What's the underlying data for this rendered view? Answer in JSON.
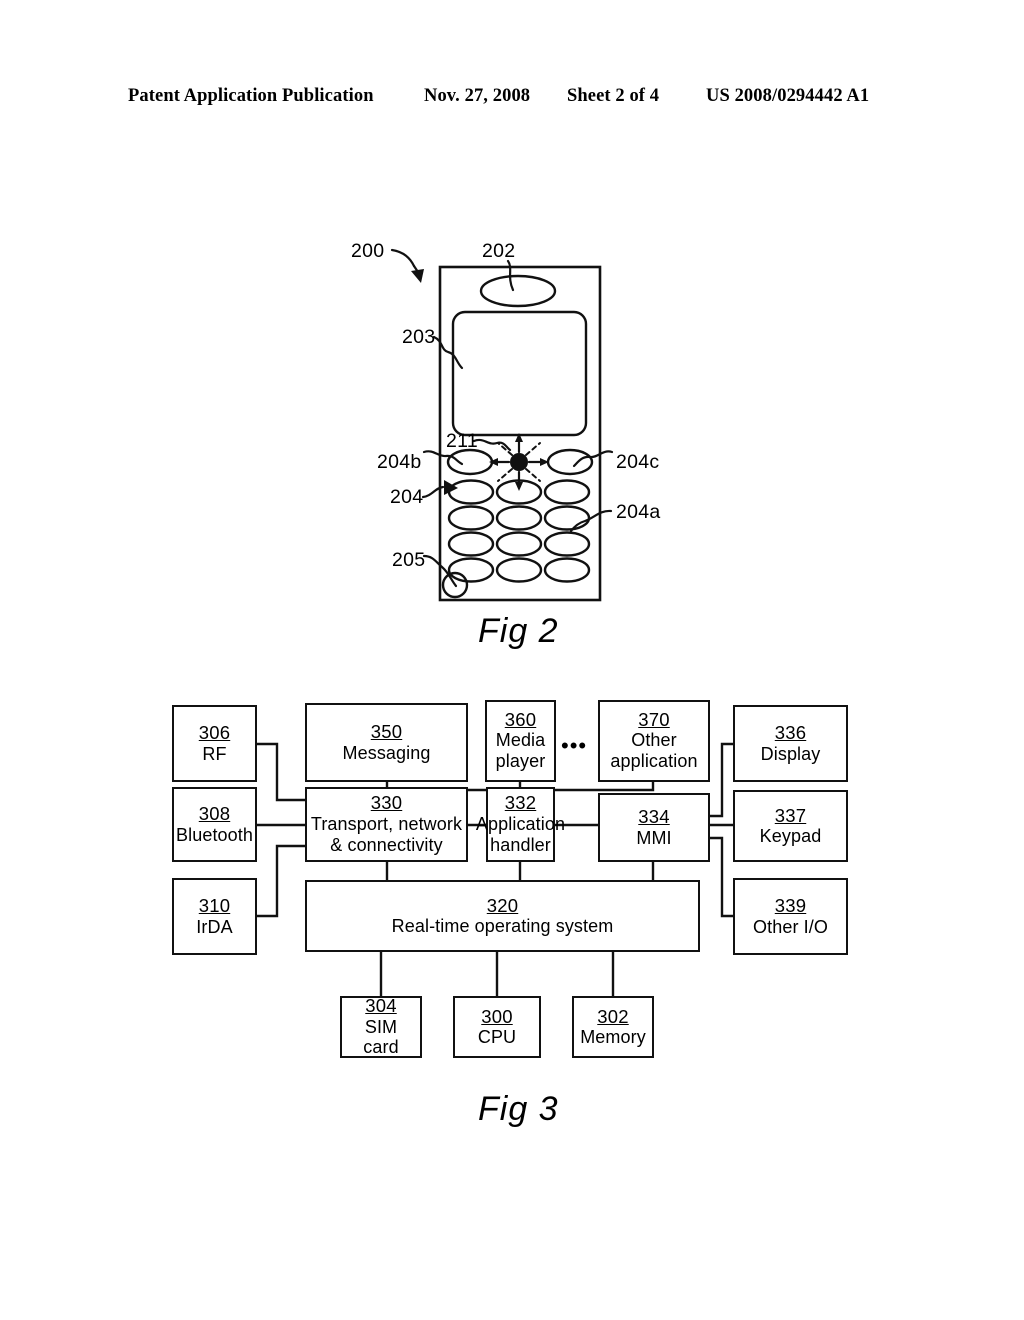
{
  "header": {
    "publication": "Patent Application Publication",
    "date": "Nov. 27, 2008",
    "sheet": "Sheet 2 of 4",
    "patent_number": "US 2008/0294442 A1"
  },
  "figures": [
    {
      "caption": "Fig 2",
      "title": "Mobile telephone front view",
      "reference_numerals": [
        {
          "id": "200",
          "label": "200",
          "target": "phone-body"
        },
        {
          "id": "202",
          "label": "202",
          "target": "speaker"
        },
        {
          "id": "203",
          "label": "203",
          "target": "display-screen"
        },
        {
          "id": "211",
          "label": "211",
          "target": "navigation-key"
        },
        {
          "id": "204b",
          "label": "204b",
          "target": "soft-key-left"
        },
        {
          "id": "204c",
          "label": "204c",
          "target": "soft-key-right"
        },
        {
          "id": "204",
          "label": "204",
          "target": "keypad"
        },
        {
          "id": "204a",
          "label": "204a",
          "target": "keypad-key"
        },
        {
          "id": "205",
          "label": "205",
          "target": "microphone"
        }
      ],
      "keypad": {
        "rows": 4,
        "columns": 3,
        "soft_keys": 2
      }
    },
    {
      "caption": "Fig 3",
      "title": "Software and hardware architecture block diagram",
      "blocks": [
        {
          "num": "306",
          "label": "RF",
          "lines": [
            "RF"
          ]
        },
        {
          "num": "308",
          "label": "Bluetooth",
          "lines": [
            "Bluetooth"
          ]
        },
        {
          "num": "310",
          "label": "IrDA",
          "lines": [
            "IrDA"
          ]
        },
        {
          "num": "350",
          "label": "Messaging",
          "lines": [
            "Messaging"
          ]
        },
        {
          "num": "360",
          "label": "Media player",
          "lines": [
            "Media",
            "player"
          ]
        },
        {
          "num": "370",
          "label": "Other application",
          "lines": [
            "Other",
            "application"
          ]
        },
        {
          "num": "330",
          "label": "Transport, network & connectivity",
          "lines": [
            "Transport, network",
            "& connectivity"
          ]
        },
        {
          "num": "332",
          "label": "Application handler",
          "lines": [
            "Application",
            "handler"
          ]
        },
        {
          "num": "334",
          "label": "MMI",
          "lines": [
            "MMI"
          ]
        },
        {
          "num": "336",
          "label": "Display",
          "lines": [
            "Display"
          ]
        },
        {
          "num": "337",
          "label": "Keypad",
          "lines": [
            "Keypad"
          ]
        },
        {
          "num": "339",
          "label": "Other I/O",
          "lines": [
            "Other I/O"
          ]
        },
        {
          "num": "320",
          "label": "Real-time operating system",
          "lines": [
            "Real-time operating system"
          ]
        },
        {
          "num": "304",
          "label": "SIM card",
          "lines": [
            "SIM card"
          ]
        },
        {
          "num": "300",
          "label": "CPU",
          "lines": [
            "CPU"
          ]
        },
        {
          "num": "302",
          "label": "Memory",
          "lines": [
            "Memory"
          ]
        }
      ],
      "ellipsis": "•••",
      "connections": [
        "306 → 330",
        "308 → 330",
        "310 → 330",
        "350 → 332",
        "360 → 332",
        "370 → 332",
        "330 → 332",
        "332 → 334",
        "334 → 336",
        "334 → 337",
        "334 → 339",
        "330 → 320",
        "332 → 320",
        "334 → 320",
        "320 → 304",
        "320 → 300",
        "320 → 302"
      ]
    }
  ],
  "style": {
    "ink": "#111111",
    "paper": "#ffffff"
  }
}
